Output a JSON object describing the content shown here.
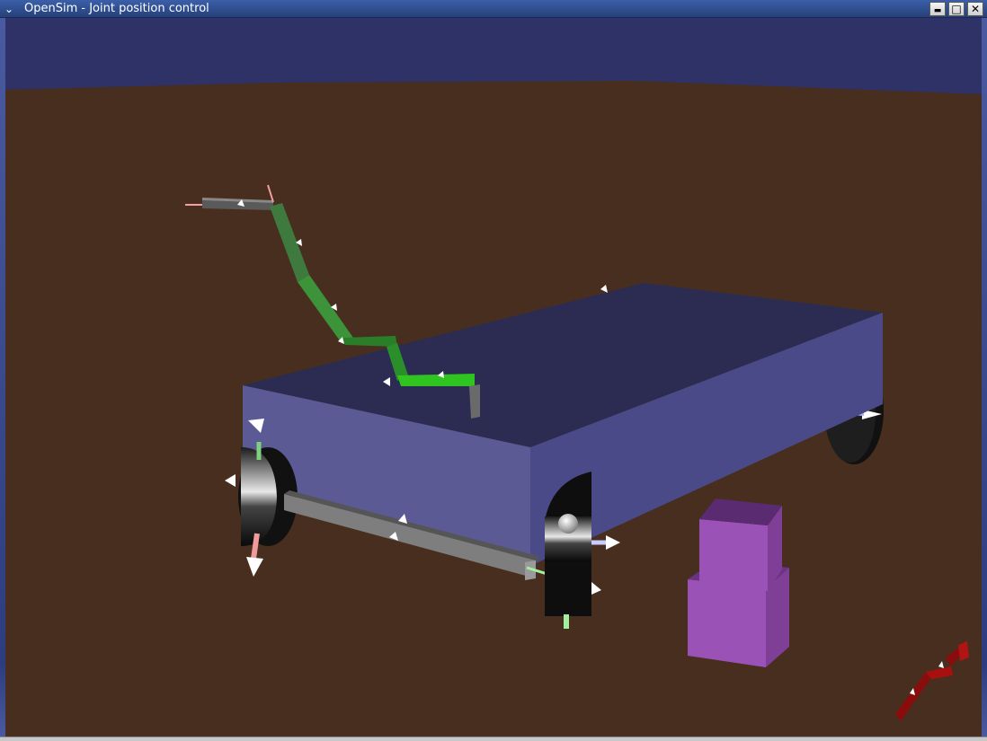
{
  "window": {
    "title": "OpenSim - Joint position control",
    "menu_icon": "chevron-down-icon",
    "controls": {
      "minimize_icon": "minimize-icon",
      "maximize_icon": "maximize-icon",
      "close_icon": "close-icon",
      "minimize_glyph": "▬",
      "maximize_glyph": "□",
      "close_glyph": "✕",
      "menu_glyph": "⌄"
    }
  },
  "scene": {
    "sky_color": "#2f3267",
    "ground_color": "#482e1f",
    "vehicle_top_color": "#2c2c52",
    "vehicle_side_color": "#5b5a95",
    "arm_color": "#2fae1f",
    "box_color": "#9a52b6",
    "mini_arm_color": "#8a0d0d"
  }
}
